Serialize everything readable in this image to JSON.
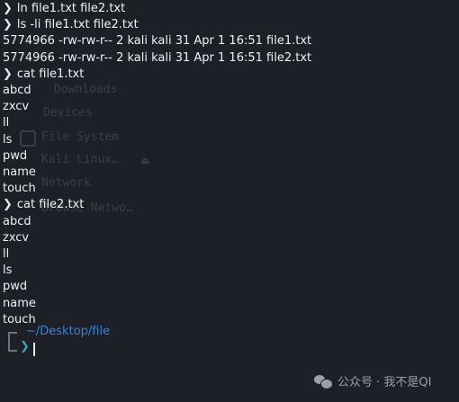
{
  "terminal": {
    "prompt_symbol": "❯",
    "lines": [
      {
        "type": "prompt",
        "text": "ln file1.txt file2.txt"
      },
      {
        "type": "prompt",
        "text": "ls -li file1.txt file2.txt"
      },
      {
        "type": "output",
        "text": "5774966 -rw-rw-r-- 2 kali kali 31 Apr  1 16:51 file1.txt"
      },
      {
        "type": "output",
        "text": "5774966 -rw-rw-r-- 2 kali kali 31 Apr  1 16:51 file2.txt"
      },
      {
        "type": "prompt",
        "text": "cat file1.txt"
      },
      {
        "type": "output",
        "text": "abcd"
      },
      {
        "type": "output",
        "text": "zxcv"
      },
      {
        "type": "output",
        "text": "ll"
      },
      {
        "type": "output",
        "text": "ls"
      },
      {
        "type": "output",
        "text": "pwd"
      },
      {
        "type": "output",
        "text": "name"
      },
      {
        "type": "output",
        "text": "touch"
      },
      {
        "type": "prompt",
        "text": "cat file2.txt"
      },
      {
        "type": "output",
        "text": "abcd"
      },
      {
        "type": "output",
        "text": "zxcv"
      },
      {
        "type": "output",
        "text": "ll"
      },
      {
        "type": "output",
        "text": "ls"
      },
      {
        "type": "output",
        "text": "pwd"
      },
      {
        "type": "output",
        "text": "name"
      },
      {
        "type": "output",
        "text": "touch"
      }
    ],
    "current_path": "~/Desktop/file",
    "end_prompt_symbol": "❯"
  },
  "background_sidebar": {
    "items": [
      "Downloads",
      "Devices",
      "File System",
      "Kali Linux…",
      "Network",
      "Browse Netwo…"
    ]
  },
  "watermark": {
    "text": "公众号 · 我不是QI"
  },
  "colors": {
    "background": "#1d2027",
    "text": "#f0f0f0",
    "path": "#3b82d6",
    "end_prompt": "#3aa6b9",
    "ghost": "#3a3e47"
  }
}
